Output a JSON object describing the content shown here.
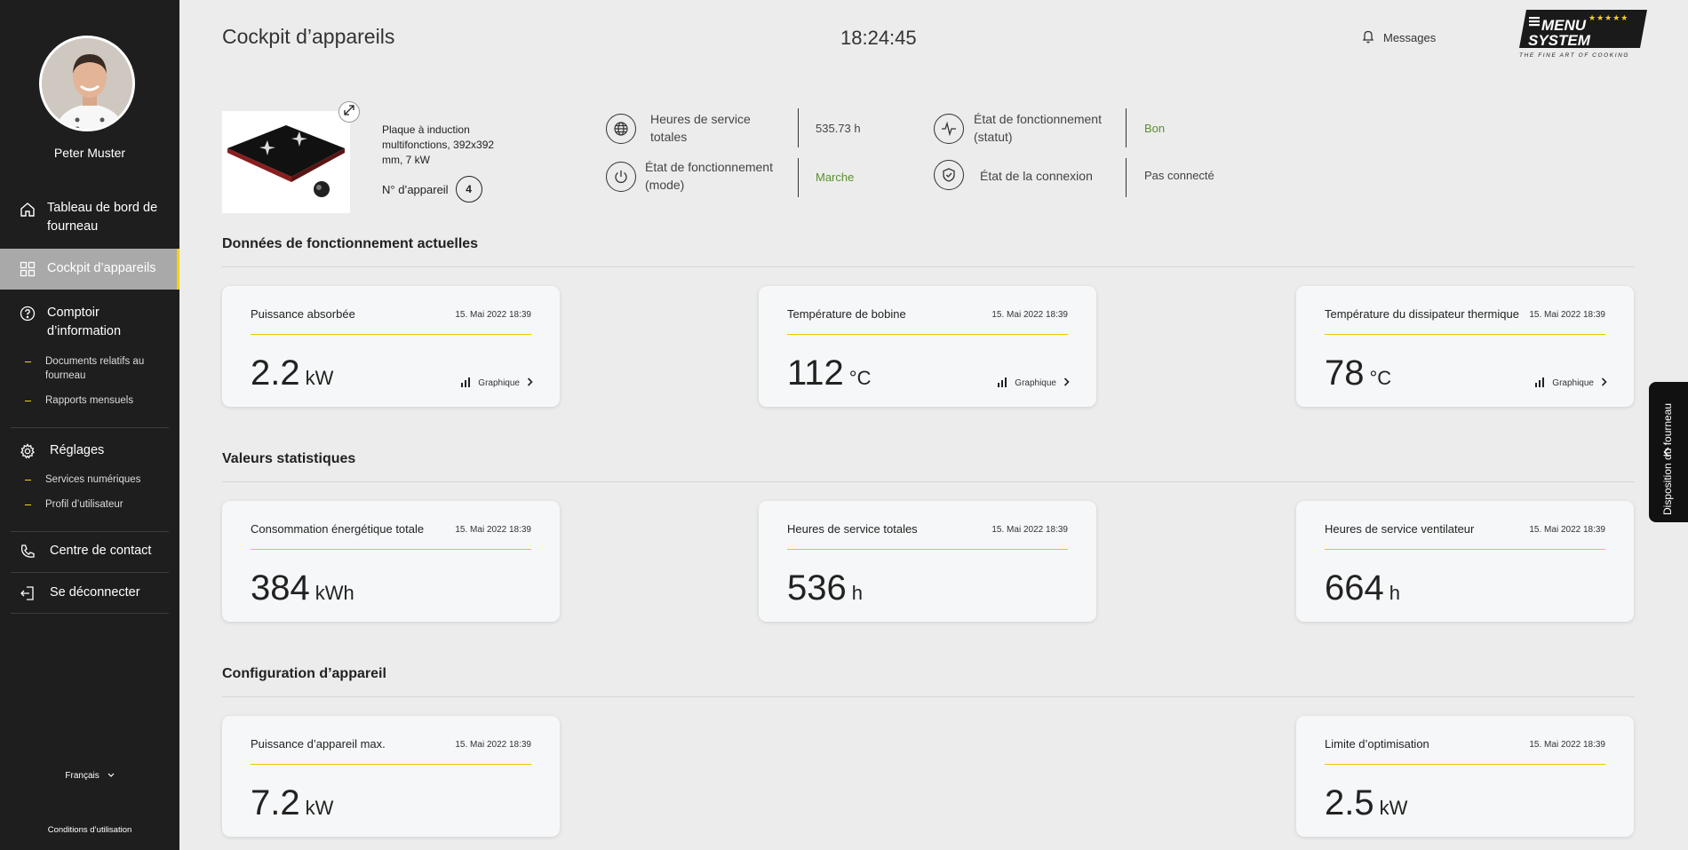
{
  "sidebar": {
    "user_name": "Peter Muster",
    "items": [
      {
        "label": "Tableau de bord de fourneau",
        "icon": "home-icon"
      },
      {
        "label": "Cockpit d’appareils",
        "icon": "grid-icon"
      },
      {
        "label": "Comptoir d’information",
        "icon": "help-circle-icon"
      },
      {
        "label": "Réglages",
        "icon": "gear-icon"
      },
      {
        "label": "Centre de contact",
        "icon": "phone-icon"
      },
      {
        "label": "Se déconnecter",
        "icon": "logout-icon"
      }
    ],
    "info_subitems": [
      "Documents relatifs au fourneau",
      "Rapports mensuels"
    ],
    "settings_subitems": [
      "Services numériques",
      "Profil d’utilisateur"
    ],
    "language": "Français",
    "terms": "Conditions d’utilisation"
  },
  "header": {
    "title": "Cockpit d’appareils",
    "time": "18:24:45",
    "messages_label": "Messages",
    "logo_line1": "MENU",
    "logo_line2": "SYSTEM",
    "logo_tagline": "THE FINE ART OF COOKING",
    "logo_stars": "★★★★★"
  },
  "device": {
    "description": "Plaque à induction multifonctions, 392x392 mm, 7 kW",
    "number_label": "N° d’appareil",
    "number": "4",
    "stats": {
      "hours_label": "Heures de service totales",
      "hours_value": "535.73 h",
      "mode_label": "État de fonctionnement (mode)",
      "mode_value": "Marche",
      "status_label": "État de fonctionnement (statut)",
      "status_value": "Bon",
      "connection_label": "État de la connexion",
      "connection_value": "Pas connecté"
    }
  },
  "sections": {
    "current": "Données de fonctionnement actuelles",
    "stats": "Valeurs statistiques",
    "config": "Configuration d’appareil"
  },
  "graph_label": "Graphique",
  "cards": {
    "power": {
      "label": "Puissance absorbée",
      "date": "15. Mai 2022 18:39",
      "value": "2.2",
      "unit": "kW"
    },
    "coil_temp": {
      "label": "Température de bobine",
      "date": "15. Mai 2022 18:39",
      "value": "112",
      "unit": "°C"
    },
    "heatsink_temp": {
      "label": "Température du dissipateur thermique",
      "date": "15. Mai 2022 18:39",
      "value": "78",
      "unit": "°C"
    },
    "energy": {
      "label": "Consommation énergétique totale",
      "date": "15. Mai 2022 18:39",
      "value": "384",
      "unit": "kWh"
    },
    "total_hours": {
      "label": "Heures de service totales",
      "date": "15. Mai 2022 18:39",
      "value": "536",
      "unit": "h"
    },
    "fan_hours": {
      "label": "Heures de service ventilateur",
      "date": "15. Mai 2022 18:39",
      "value": "664",
      "unit": "h"
    },
    "max_power": {
      "label": "Puissance d’appareil max.",
      "date": "15. Mai 2022 18:39",
      "value": "7.2",
      "unit": "kW"
    },
    "optim_limit": {
      "label": "Limite d’optimisation",
      "date": "15. Mai 2022 18:39",
      "value": "2.5",
      "unit": "kW"
    }
  },
  "side_tab": "Disposition du fourneau",
  "colors": {
    "accent": "#f1d31b",
    "sidebar": "#1e1e1e",
    "status_green": "#5a8f2e"
  }
}
